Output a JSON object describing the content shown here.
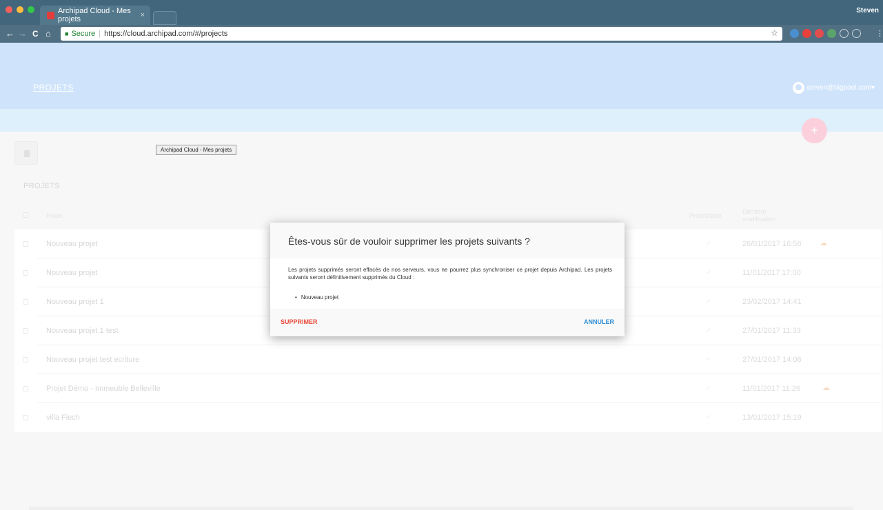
{
  "browser": {
    "tab_title": "Archipad Cloud - Mes projets",
    "tab_close": "×",
    "profile_name": "Steven",
    "secure_label": "Secure",
    "url": "https://cloud.archipad.com/#/projects",
    "nav": {
      "back": "←",
      "forward": "→",
      "reload": "C",
      "home": "⌂",
      "star": "☆"
    }
  },
  "header": {
    "title": "PROJETS",
    "account_email": "steven@bigpool.com",
    "account_caret": "▾",
    "add_label": "+"
  },
  "toolbar": {
    "tooltip": "Archipad Cloud - Mes projets"
  },
  "list": {
    "section_title": "PROJETS",
    "columns": {
      "project": "Projet",
      "owner": "Propriétaire",
      "modified": "Dernière modification"
    },
    "check_mark": "✓",
    "sync_mark": "☁",
    "rows": [
      {
        "name": "Nouveau projet",
        "date": "26/01/2017 16:56",
        "synced": true
      },
      {
        "name": "Nouveau projet",
        "date": "11/01/2017 17:00",
        "synced": false
      },
      {
        "name": "Nouveau projet 1",
        "date": "23/02/2017 14:41",
        "synced": false
      },
      {
        "name": "Nouveau projet 1 test",
        "date": "27/01/2017 11:33",
        "synced": false
      },
      {
        "name": "Nouveau projet test ecriture",
        "date": "27/01/2017 14:06",
        "synced": false
      },
      {
        "name": "Projet Démo - Immeuble Belleville",
        "date": "11/01/2017 11:26",
        "synced": true
      },
      {
        "name": "villa Flech",
        "date": "13/01/2017 15:19",
        "synced": false
      }
    ]
  },
  "dialog": {
    "title": "Êtes-vous sûr de vouloir supprimer les projets suivants ?",
    "message": "Les projets supprimés seront effacés de nos serveurs, vous ne pourrez plus synchroniser ce projet depuis Archipad. Les projets suivants seront définitivement supprimés du Cloud :",
    "items": [
      "Nouveau projet"
    ],
    "delete_label": "SUPPRIMER",
    "cancel_label": "ANNULER"
  },
  "colors": {
    "header_bg": "#cfe4fb",
    "subbar_bg": "#ddf0fb",
    "fab": "#fbd0dc",
    "delete": "#e84b3c",
    "cancel": "#2f8fd6"
  }
}
